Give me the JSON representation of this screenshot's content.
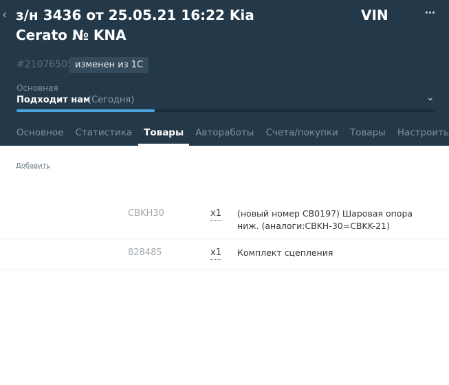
{
  "header": {
    "back_icon": "chevron-left-icon",
    "title": "з/н 3436 от 25.05.21 16:22 Kia Cerato № KNA",
    "vin": "VIN",
    "menu_icon": "more-horizontal-icon",
    "menu_glyph": "···",
    "order_id": "#21076505",
    "badge": "изменен из 1С"
  },
  "stage": {
    "label": "Основная",
    "value": "Подходит нам",
    "date": "(Сегодня)",
    "chevron_icon": "chevron-down-icon",
    "progress_fraction": 0.33
  },
  "tabs": [
    {
      "label": "Основное",
      "active": false
    },
    {
      "label": "Статистика",
      "active": false
    },
    {
      "label": "Товары",
      "active": true
    },
    {
      "label": "Авторaботы",
      "active": false
    },
    {
      "label": "Счета/покупки",
      "active": false
    },
    {
      "label": "Товары",
      "active": false
    },
    {
      "label": "Настроить",
      "active": false
    }
  ],
  "content": {
    "add_label": "Добавить",
    "items": [
      {
        "code": "CBKH30",
        "qty": "x1",
        "description": "(новый номер CB0197) Шаровая опора ниж. (аналоги:CBKH-30=CBKK-21)"
      },
      {
        "code": "828485",
        "qty": "x1",
        "description": "Комплект сцепления"
      }
    ]
  },
  "colors": {
    "header_bg": "#23394a",
    "accent": "#4aa3df"
  }
}
